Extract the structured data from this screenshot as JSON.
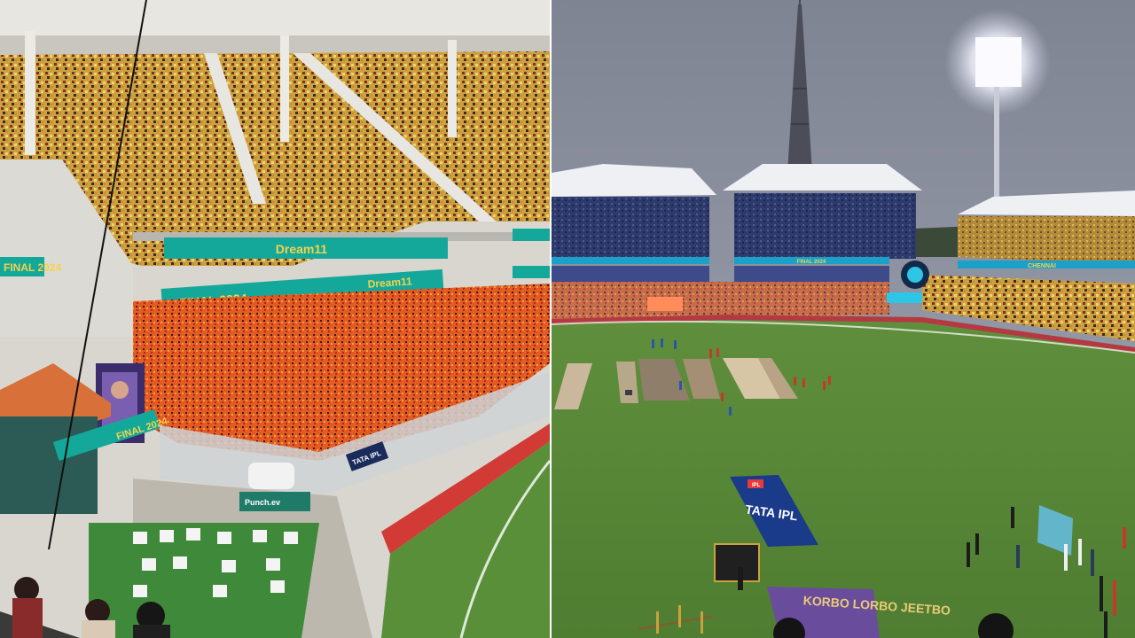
{
  "left_panel": {
    "banner_primary": "FINAL 2024",
    "banner_secondary": "FINAL 2024",
    "banner_side": "FINAL 2024",
    "sponsor_small": "TATA IPL",
    "sponsor_vehicle_sign": "Punch.ev",
    "sponsor_top": "Dream11",
    "sponsor_mid": "Dream11"
  },
  "right_panel": {
    "ground_banner": "FINAL 2024",
    "stand_banner": "CHENNAI",
    "mat_text": "TATA IPL",
    "mat_logo": "IPL",
    "motto_text": "KORBO LORBO JEETBO"
  },
  "colors": {
    "sky": "#8a8f9c",
    "grass": "#5c8a3a",
    "seats_yellow": "#e3b53a",
    "signage_teal": "#14a89a",
    "kkr_purple": "#6a4c9c"
  }
}
